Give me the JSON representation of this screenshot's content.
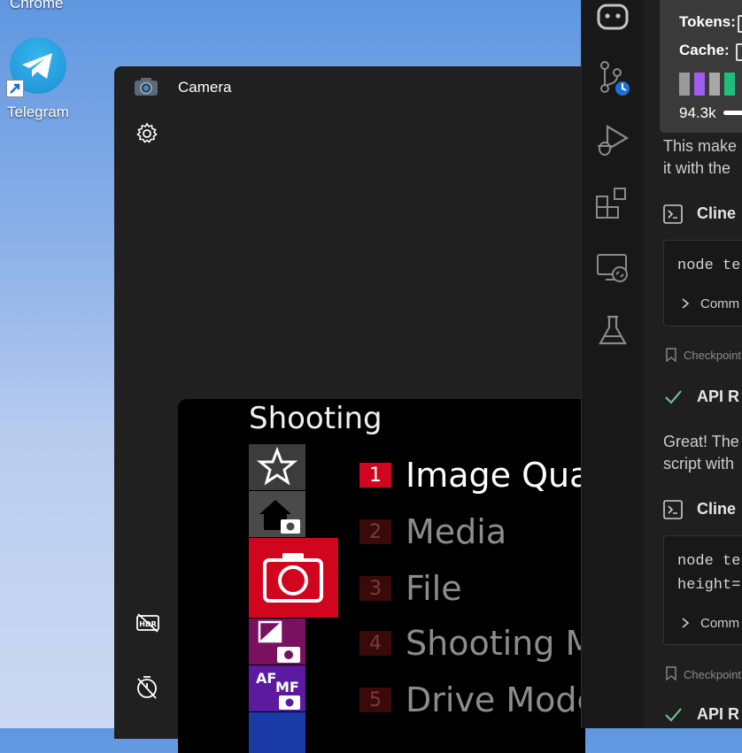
{
  "desktop": {
    "chrome_label": "Chrome",
    "telegram_label": "Telegram"
  },
  "camera": {
    "title": "Camera",
    "menu": {
      "heading": "Shooting",
      "items": [
        {
          "num": "1",
          "label": "Image Quality"
        },
        {
          "num": "2",
          "label": "Media"
        },
        {
          "num": "3",
          "label": "File"
        },
        {
          "num": "4",
          "label": "Shooting Mod"
        },
        {
          "num": "5",
          "label": "Drive Mode"
        }
      ],
      "af_label": "AF",
      "mf_label": "MF"
    }
  },
  "tooltip": {
    "tokens_label": "Tokens:",
    "cache_label": "Cache:",
    "usage_value": "94.3k",
    "swatch_colors": [
      "#9a9a9a",
      "#a15cf0",
      "#a8a8a8",
      "#1fbf7a"
    ]
  },
  "chat": {
    "para1_line1": "This make",
    "para1_line2": "it with the",
    "cline1_label": "Cline",
    "code1_line1": "node te",
    "command1_label": "Comm",
    "checkpoint1": "Checkpoint",
    "api1_label": "API R",
    "para2_line1": "Great! The",
    "para2_line2": "script with",
    "cline2_label": "Cline",
    "code2_line1": "node te",
    "code2_line2": "height=",
    "command2_label": "Comm",
    "checkpoint2": "Checkpoint",
    "api2_label": "API R"
  }
}
